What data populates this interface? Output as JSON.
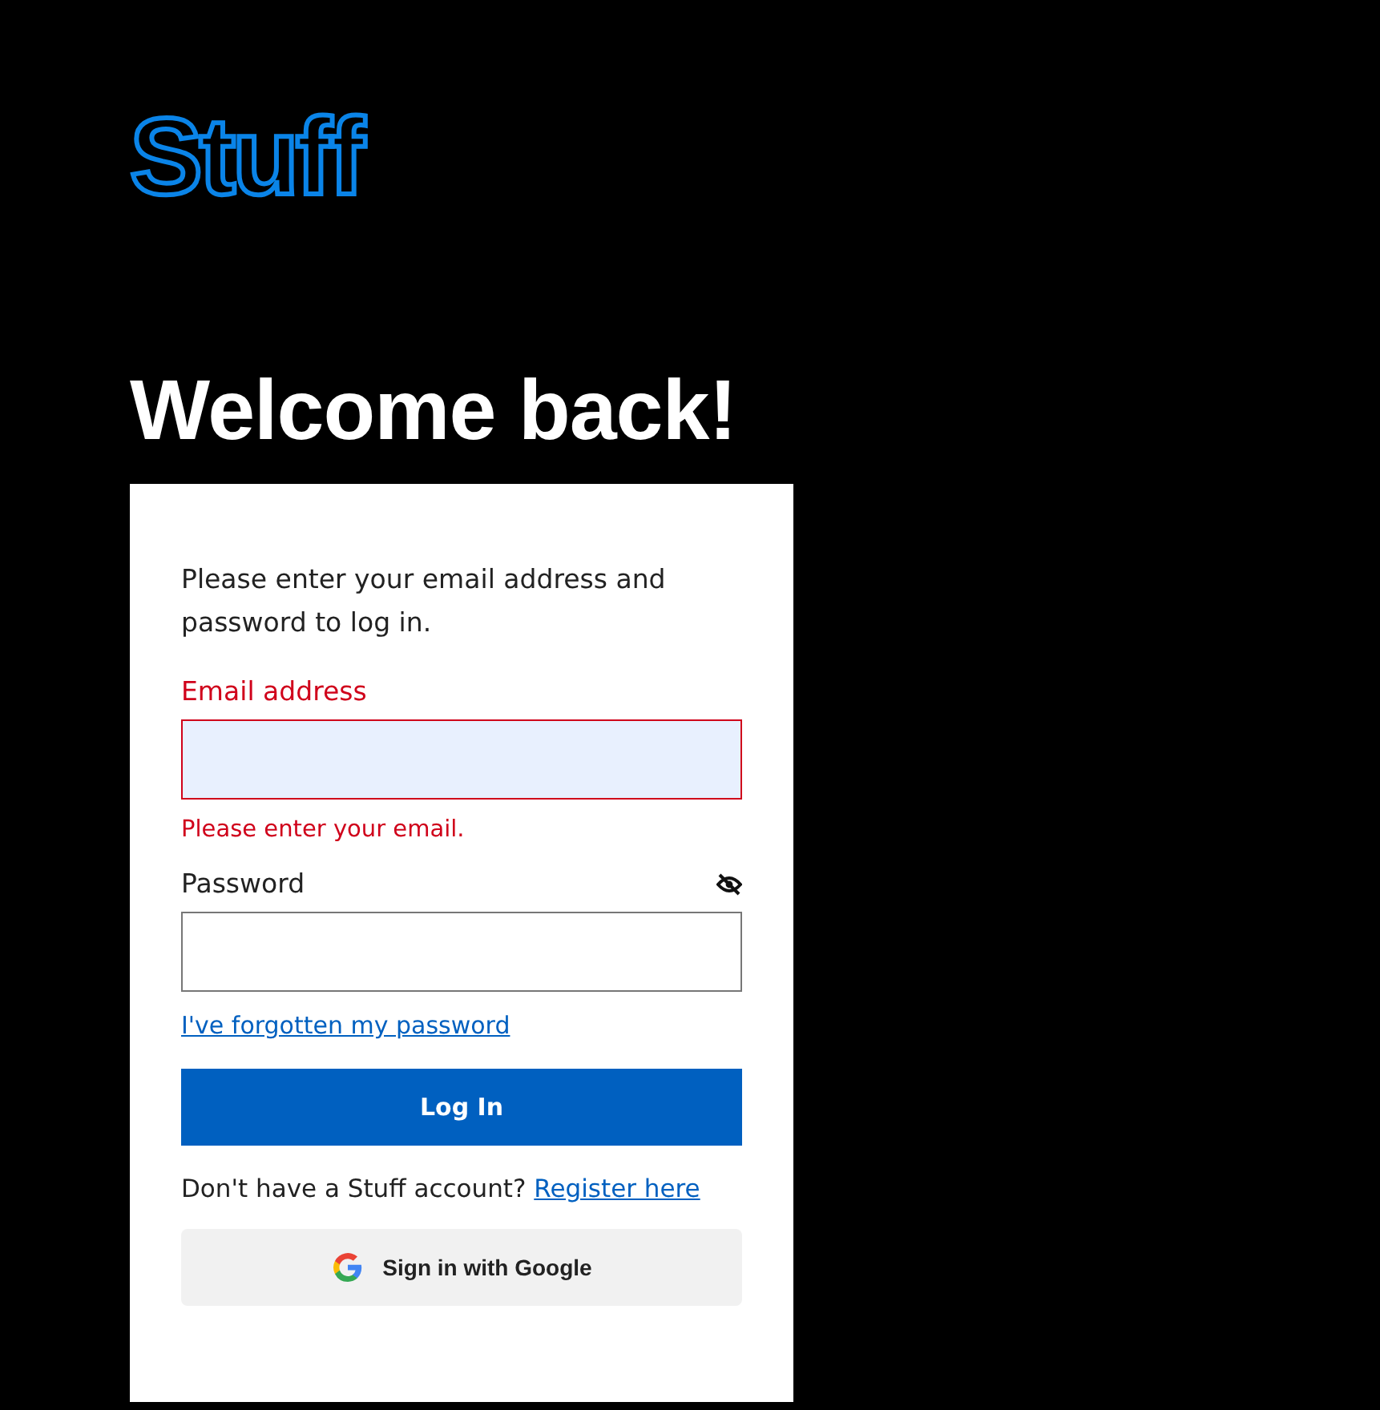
{
  "logo": "Stuff",
  "heading": "Welcome back!",
  "intro": "Please enter your email address and password to log in.",
  "fields": [
    {
      "kind": "email",
      "label": "Email address",
      "error": true,
      "autofilled": true,
      "error_text": "Please enter your email."
    },
    {
      "kind": "password",
      "label": "Password",
      "error": false,
      "autofilled": false
    }
  ],
  "forgot_link": "I've forgotten my password",
  "login_button": "Log In",
  "register": {
    "text": "Don't have a Stuff account?",
    "link": "Register here"
  },
  "google_button": "Sign in with Google"
}
